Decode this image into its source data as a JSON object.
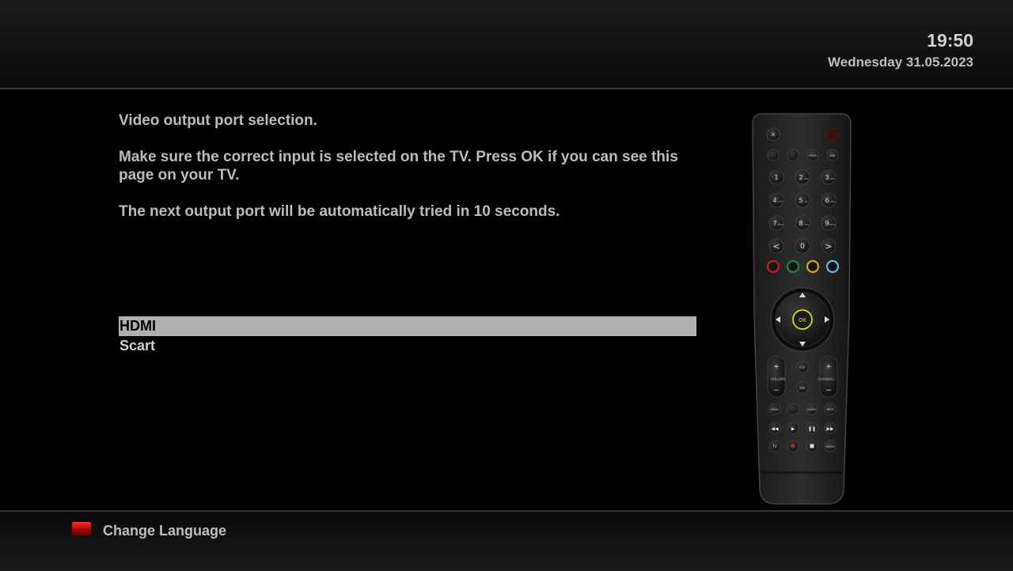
{
  "header": {
    "time": "19:50",
    "date": "Wednesday 31.05.2023"
  },
  "main": {
    "heading": "Video output port selection.",
    "instruction": "Make sure the correct input is selected on the TV. Press OK if you can see this page on your TV.",
    "timer_text": "The next output port will be automatically tried in 10 seconds."
  },
  "ports": [
    {
      "label": "HDMI",
      "selected": true
    },
    {
      "label": "Scart",
      "selected": false
    }
  ],
  "remote": {
    "top_keys": [
      "HOME",
      "END"
    ],
    "digits": [
      {
        "n": "1",
        "s": ""
      },
      {
        "n": "2",
        "s": "ABC"
      },
      {
        "n": "3",
        "s": "DEF"
      },
      {
        "n": "4",
        "s": "GHI"
      },
      {
        "n": "5",
        "s": "JKL"
      },
      {
        "n": "6",
        "s": "MNO"
      },
      {
        "n": "7",
        "s": "PQRS"
      },
      {
        "n": "8",
        "s": "TUV"
      },
      {
        "n": "9",
        "s": "WXYZ"
      }
    ],
    "zero": "0",
    "ok": "OK",
    "volume": "VOLUME",
    "channel": "CHANNEL",
    "exit": "EXIT",
    "epg": "EPG",
    "row_keys": [
      "MENU",
      "AUDIO",
      "HELP"
    ],
    "tv": "TV",
    "radio": "RADIO",
    "color_keys": [
      "#c62020",
      "#1f8a3a",
      "#d7a21c",
      "#6fb3e8"
    ]
  },
  "footer": {
    "red_key_label": "Change Language",
    "red_key_color": "#d11a1a"
  }
}
